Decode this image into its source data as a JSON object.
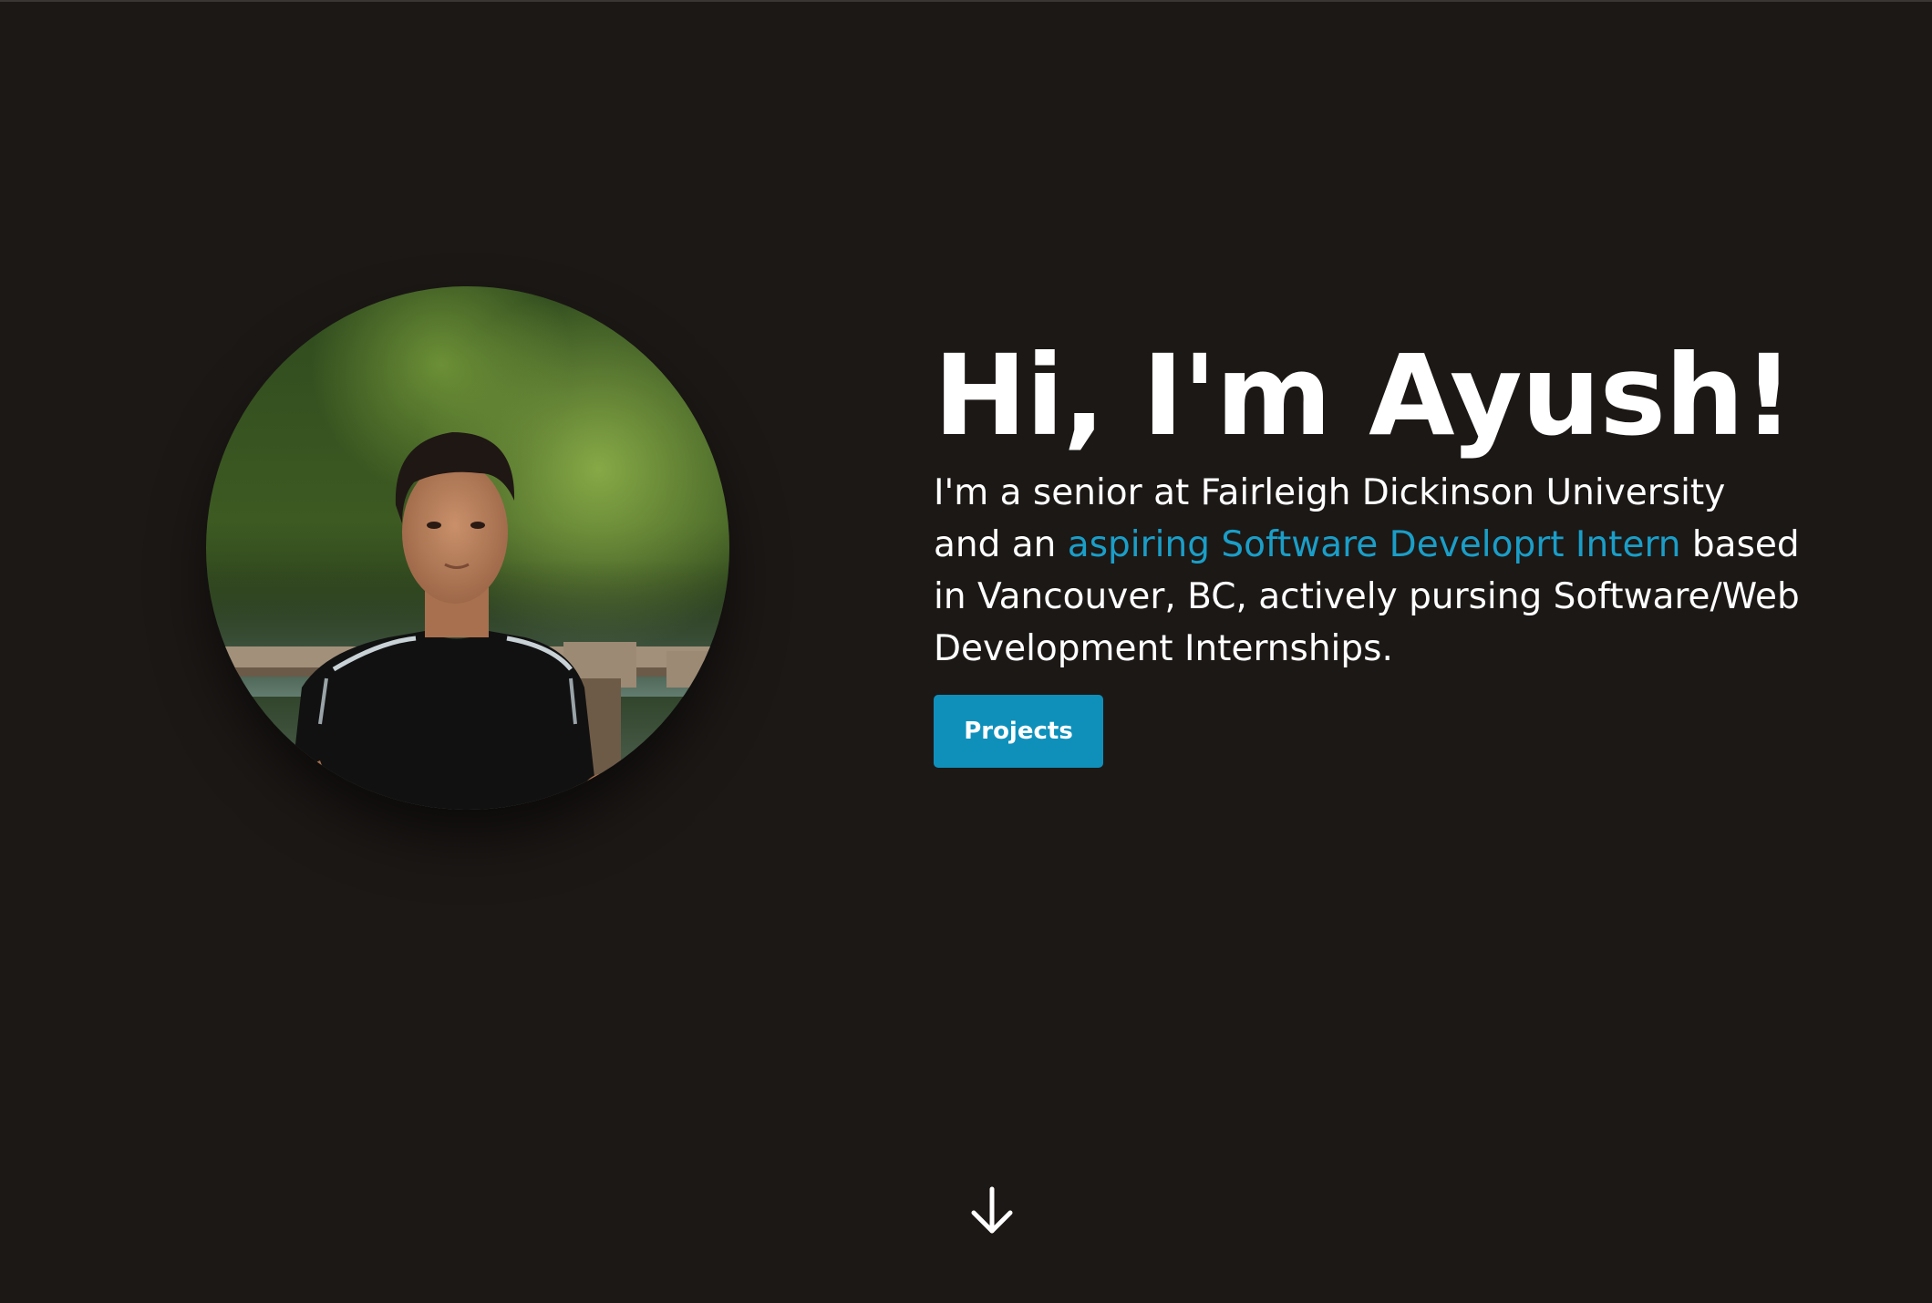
{
  "hero": {
    "title": "Hi, I'm Ayush!",
    "bio": {
      "before": "I'm a senior at Fairleigh Dickinson University and an ",
      "highlight": "aspiring Software Developrt Intern",
      "after": " based in Vancouver, BC, actively pursing Software/Web Development Internships."
    },
    "projects_button": "Projects",
    "scroll_icon": "arrow-down-icon"
  },
  "colors": {
    "background": "#1c1816",
    "accent": "#1a9ec8",
    "button": "#0f90bb",
    "text": "#ffffff"
  }
}
